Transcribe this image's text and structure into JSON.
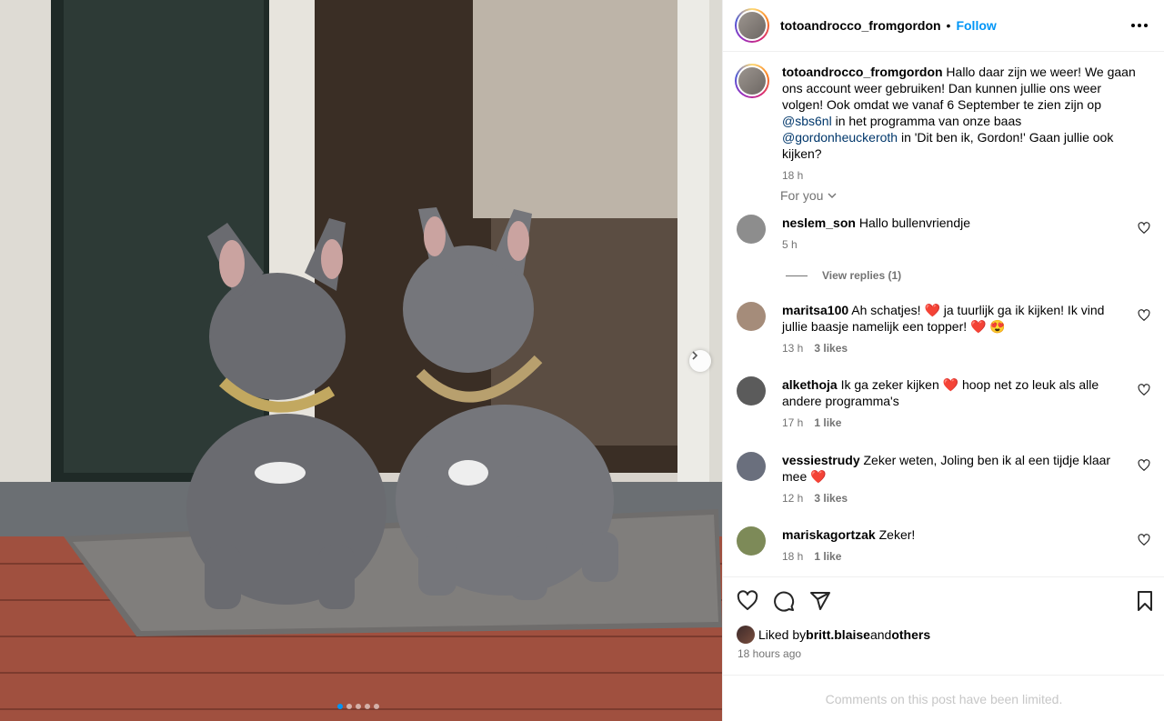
{
  "post": {
    "username": "totoandrocco_fromgordon",
    "follow_label": "Follow",
    "header_separator": "•"
  },
  "caption": {
    "username": "totoandrocco_fromgordon",
    "text_1": " Hallo daar zijn we weer! We gaan ons account weer gebruiken! Dan kunnen jullie ons weer volgen! Ook omdat we vanaf 6 September te zien zijn op ",
    "mention_1": "@sbs6nl",
    "text_2": " in het programma van onze baas ",
    "mention_2": "@gordonheuckeroth",
    "text_3": " in 'Dit ben ik, Gordon!' Gaan jullie ook kijken?",
    "time": "18 h"
  },
  "for_you_label": "For you",
  "comments": [
    {
      "username": "neslem_son",
      "text": " Hallo bullenvriendje",
      "time": "5 h",
      "likes": "",
      "avatar_color": "#8d8d8d"
    },
    {
      "username": "maritsa100",
      "text": " Ah schatjes! ❤️ ja tuurlijk ga ik kijken! Ik vind jullie baasje namelijk een topper! ❤️ 😍",
      "time": "13 h",
      "likes": "3 likes",
      "avatar_color": "#a58c7a"
    },
    {
      "username": "alkethoja",
      "text": " Ik ga zeker kijken ❤️ hoop net zo leuk als alle andere programma's",
      "time": "17 h",
      "likes": "1 like",
      "avatar_color": "#5b5b5b"
    },
    {
      "username": "vessiestrudy",
      "text": " Zeker weten, Joling ben ik al een tijdje klaar mee ❤️",
      "time": "12 h",
      "likes": "3 likes",
      "avatar_color": "#6a6f7d"
    },
    {
      "username": "mariskagortzak",
      "text": " Zeker!",
      "time": "18 h",
      "likes": "1 like",
      "avatar_color": "#7d8a58"
    }
  ],
  "view_replies_label": "View replies (1)",
  "likes": {
    "prefix": "Liked by ",
    "user": "britt.blaise",
    "middle": " and ",
    "others": "others"
  },
  "posted_ago": "18 hours ago",
  "comments_limited": "Comments on this post have been limited.",
  "carousel": {
    "slide_count": 5,
    "active_index": 0
  },
  "colors": {
    "link_blue": "#0095f6",
    "mention_navy": "#00376b",
    "muted": "#737373",
    "heart_red": "#ff3040"
  },
  "icons": [
    "more-options-icon",
    "heart-icon",
    "comment-icon",
    "share-icon",
    "bookmark-icon",
    "chevron-down-icon",
    "chevron-right-icon"
  ]
}
